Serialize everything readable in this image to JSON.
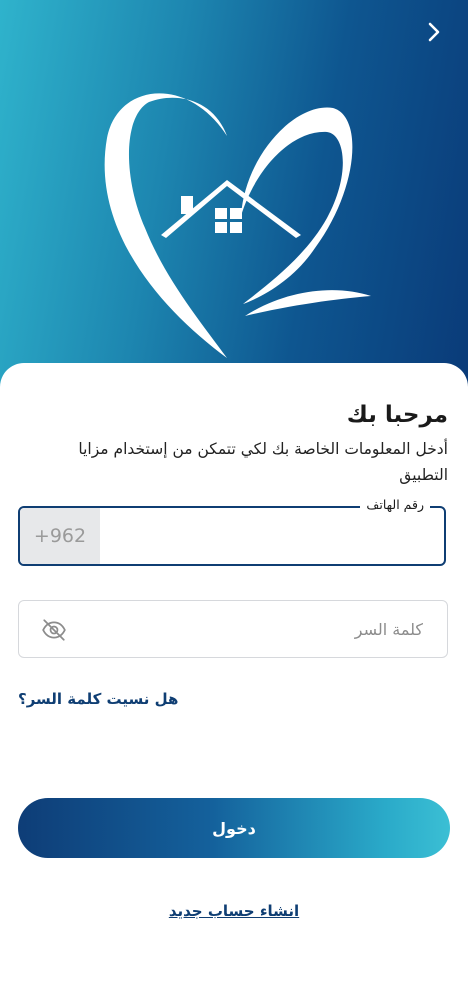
{
  "hero": {
    "background_gradient": [
      "#2fb3cc",
      "#0a3a78"
    ],
    "back_icon": "chevron-right-icon",
    "logo_icon": "heart-house-logo"
  },
  "login": {
    "title": "مرحبا بك",
    "subtitle": "أدخل المعلومات الخاصة بك لكي تتمكن من إستخدام مزايا التطبيق",
    "phone_label": "رقم الهاتف",
    "country_code": "+962",
    "phone_value": "",
    "password_placeholder": "كلمة السر",
    "password_icon": "eye-off-icon",
    "forgot_password": "هل نسيت كلمة السر؟",
    "login_button": "دخول",
    "create_account": "انشاء حساب جديد"
  },
  "colors": {
    "primary": "#0f3e73",
    "accent": "#2aaac9",
    "field_border": "#d6d8dc",
    "country_code_bg": "#e7e8ea"
  }
}
